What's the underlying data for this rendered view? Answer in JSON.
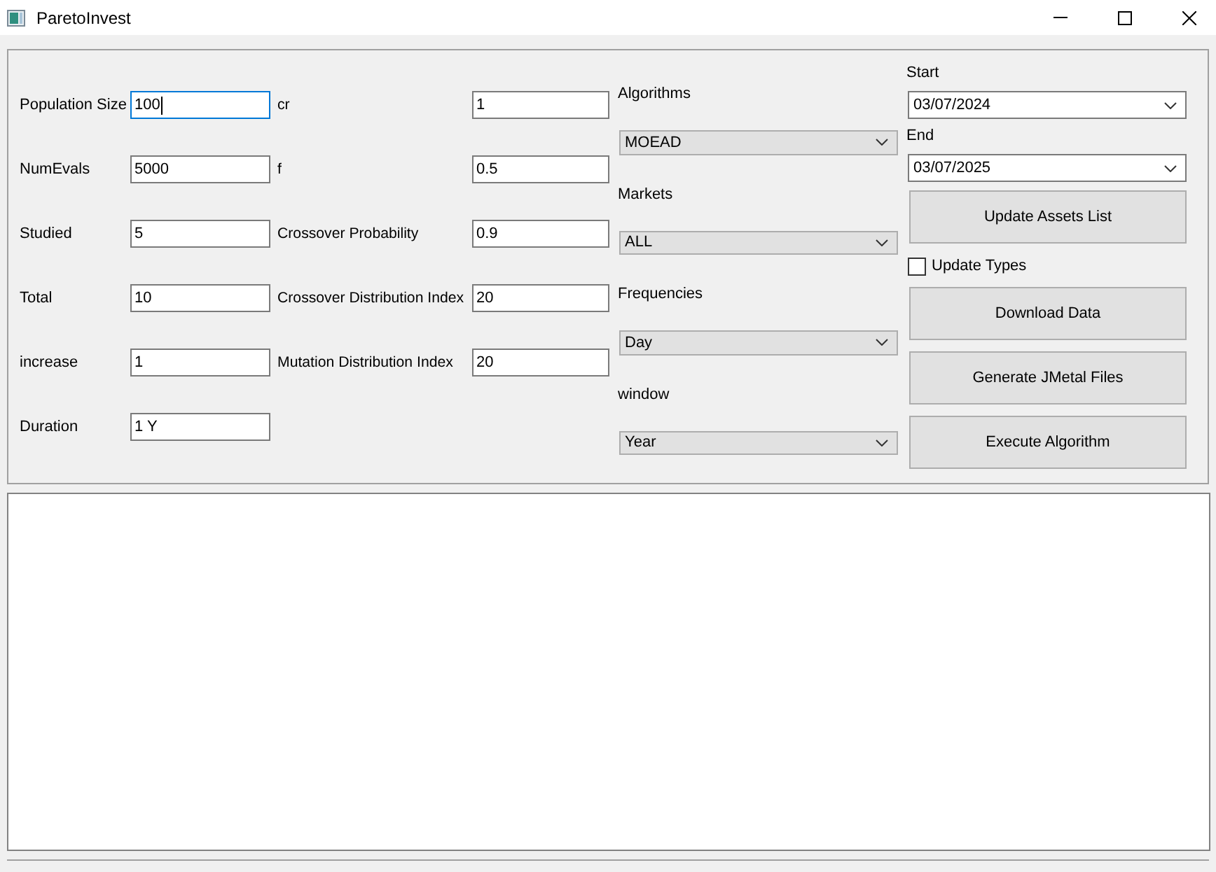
{
  "window": {
    "title": "ParetoInvest"
  },
  "settings": [
    {
      "label": "Population Size",
      "value": "100",
      "focused": true
    },
    {
      "label": "NumEvals",
      "value": "5000",
      "focused": false
    },
    {
      "label": "Studied",
      "value": "5",
      "focused": false
    },
    {
      "label": "Total",
      "value": "10",
      "focused": false
    },
    {
      "label": "increase",
      "value": "1",
      "focused": false
    },
    {
      "label": "Duration",
      "value": "1 Y",
      "focused": false
    }
  ],
  "operator_settings": [
    {
      "label": "cr",
      "value": "1",
      "focused": false
    },
    {
      "label": "f",
      "value": "0.5",
      "focused": false
    },
    {
      "label": "Crossover Probability",
      "value": "0.9",
      "focused": false
    },
    {
      "label": "Crossover Distribution Index",
      "value": "20",
      "focused": false
    },
    {
      "label": "Mutation Distribution Index",
      "value": "20",
      "focused": false
    }
  ],
  "selectors": [
    {
      "label": "Algorithms",
      "value": "MOEAD"
    },
    {
      "label": "Markets",
      "value": "ALL"
    },
    {
      "label": "Frequencies",
      "value": "Day"
    },
    {
      "label": "window",
      "value": "Year"
    }
  ],
  "dates": [
    {
      "label": "Start",
      "value": "03/07/2024"
    },
    {
      "label": "End",
      "value": "03/07/2025"
    }
  ],
  "actions": [
    {
      "kind": "button",
      "label": "Update Assets List"
    },
    {
      "kind": "checkbox",
      "label": "Update Types",
      "checked": false
    },
    {
      "kind": "button",
      "label": "Download Data"
    },
    {
      "kind": "button",
      "label": "Generate JMetal Files"
    },
    {
      "kind": "button",
      "label": "Execute Algorithm"
    }
  ]
}
